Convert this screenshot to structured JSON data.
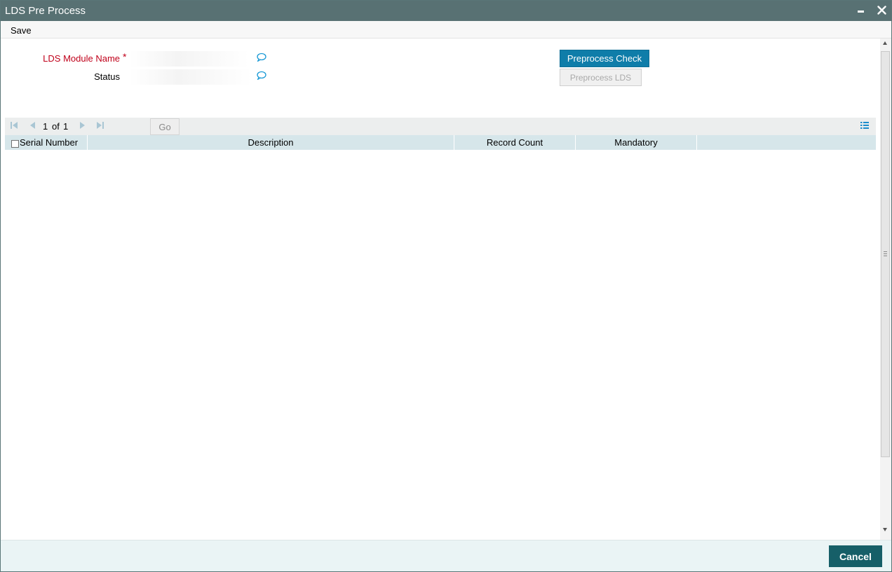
{
  "window": {
    "title": "LDS Pre Process"
  },
  "menu": {
    "save_label": "Save"
  },
  "form": {
    "module_name_label": "LDS Module Name",
    "required_marker": "*",
    "module_name_value": "",
    "status_label": "Status",
    "status_value": ""
  },
  "buttons": {
    "preprocess_check": "Preprocess Check",
    "preprocess_lds": "Preprocess LDS",
    "cancel": "Cancel"
  },
  "pagination": {
    "current": "1",
    "of": "of",
    "total": "1",
    "go_label": "Go"
  },
  "grid": {
    "columns": [
      "Serial Number",
      "Description",
      "Record Count",
      "Mandatory"
    ],
    "rows": []
  },
  "colors": {
    "titlebar": "#587173",
    "primary_button": "#0f7da9",
    "cancel_button": "#165f68",
    "required_label": "#c0001a",
    "grid_header": "#d6e6ea"
  }
}
